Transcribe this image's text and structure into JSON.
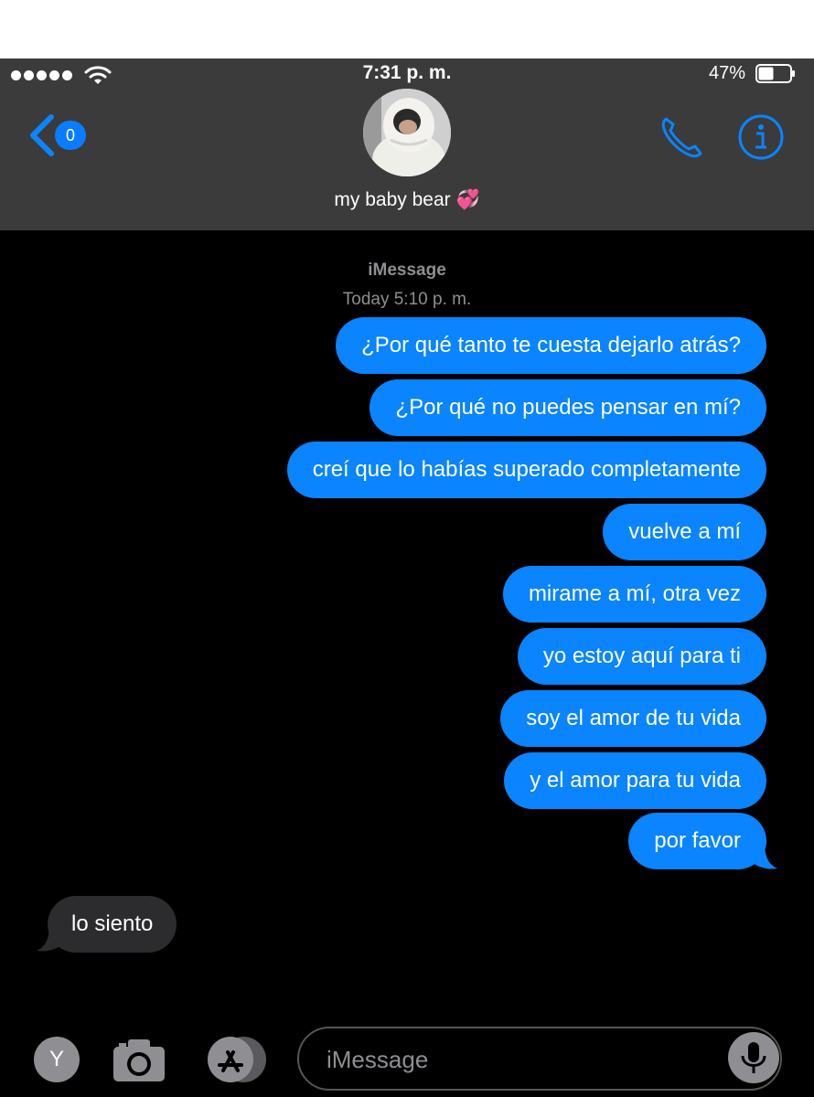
{
  "status_bar": {
    "time": "7:31 p. m.",
    "battery_percent": "47%",
    "signal_bars": 5,
    "battery_level": 0.47
  },
  "header": {
    "back_badge": "0",
    "contact_name": "my baby bear 💞"
  },
  "conversation": {
    "service": "iMessage",
    "timestamp": "Today 5:10 p. m.",
    "sent_messages": [
      "¿Por qué tanto te cuesta dejarlo atrás?",
      "¿Por qué no puedes pensar en mí?",
      "creí que lo habías superado completamente",
      "vuelve a mí",
      "mirame a mí, otra vez",
      "yo estoy aquí para ti",
      "soy el amor de tu vida",
      "y el amor para tu vida",
      "por favor"
    ],
    "received_messages": [
      "lo siento"
    ]
  },
  "input_bar": {
    "avatar_letter": "Y",
    "placeholder": "iMessage"
  },
  "colors": {
    "accent": "#0a84ff",
    "sent_bubble": "#0a84ff",
    "received_bubble": "#2c2c2e",
    "header_bg": "#3b3b3b",
    "secondary_text": "#8e8e93"
  },
  "icons": [
    "wifi-icon",
    "battery-icon",
    "back-chevron-icon",
    "phone-icon",
    "info-icon",
    "camera-icon",
    "app-store-icon",
    "microphone-icon"
  ]
}
